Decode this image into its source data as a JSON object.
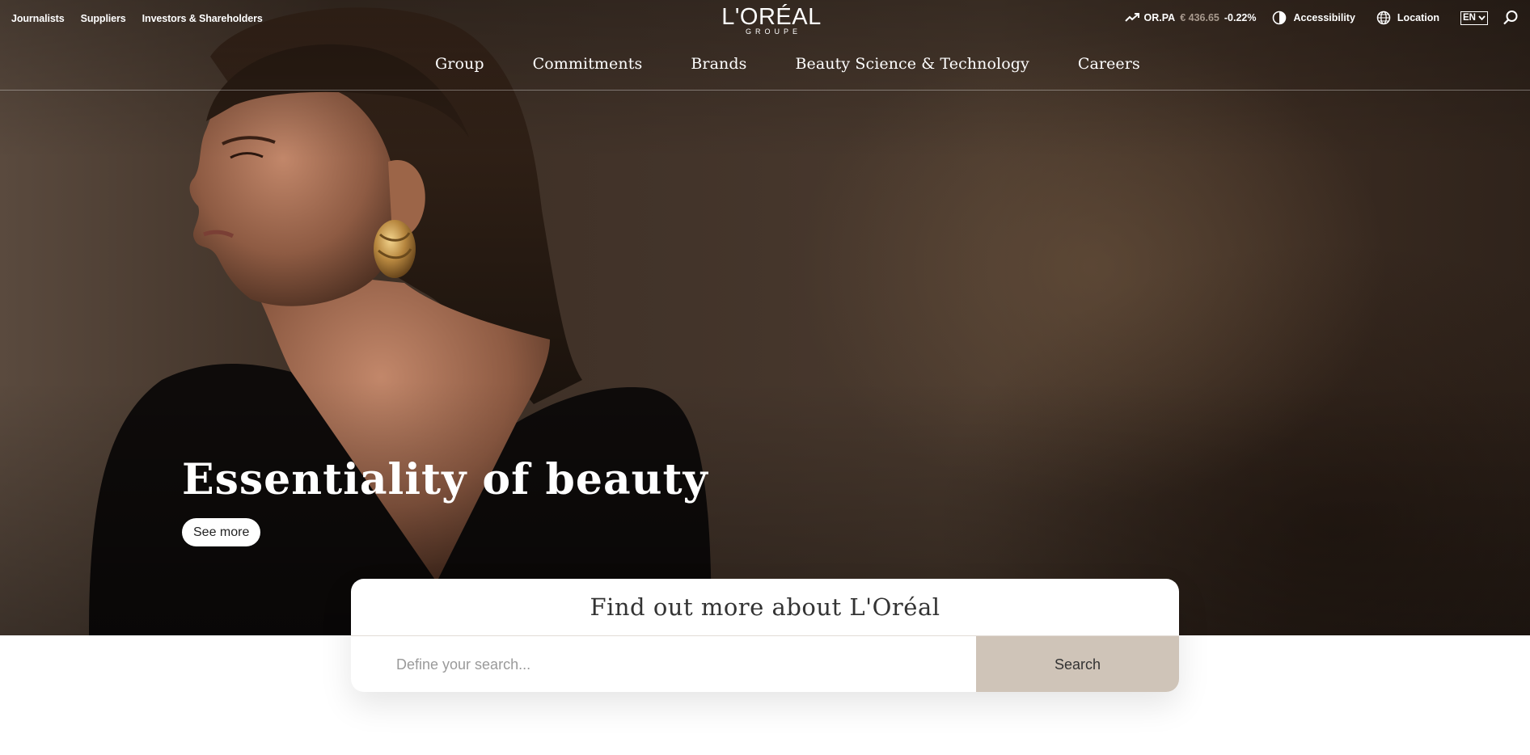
{
  "utility_nav": {
    "left_links": [
      "Journalists",
      "Suppliers",
      "Investors & Shareholders"
    ],
    "stock": {
      "ticker": "OR.PA",
      "price": "€ 436.65",
      "change": "-0.22%"
    },
    "accessibility_label": "Accessibility",
    "location_label": "Location",
    "language": "EN"
  },
  "logo": {
    "wordmark": "L'ORÉAL",
    "subline": "GROUPE"
  },
  "main_nav": [
    "Group",
    "Commitments",
    "Brands",
    "Beauty Science & Technology",
    "Careers"
  ],
  "hero": {
    "title": "Essentiality of beauty",
    "cta_label": "See more"
  },
  "search": {
    "title": "Find out more about L'Oréal",
    "placeholder": "Define your search...",
    "button_label": "Search"
  },
  "colors": {
    "search_button_bg": "#cfc4b8",
    "stock_price": "#a89a8e",
    "hero_bg": "#3d2f25"
  },
  "icons": [
    "trend-up-icon",
    "contrast-icon",
    "globe-icon",
    "chevron-down-icon",
    "search-icon"
  ]
}
